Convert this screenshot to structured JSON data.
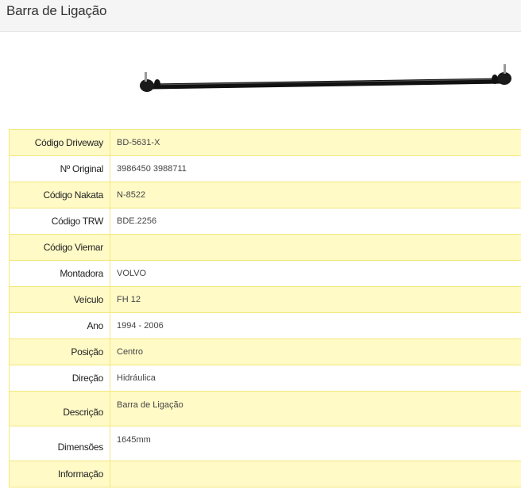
{
  "header": {
    "title": "Barra de Ligação"
  },
  "product_image": {
    "alt_icon": "tie-rod-image"
  },
  "specs": [
    {
      "label": "Código Driveway",
      "value": "BD-5631-X"
    },
    {
      "label": "Nº Original",
      "value": "3986450 3988711"
    },
    {
      "label": "Código Nakata",
      "value": "N-8522"
    },
    {
      "label": "Código TRW",
      "value": "BDE.2256"
    },
    {
      "label": "Código Viemar",
      "value": ""
    },
    {
      "label": "Montadora",
      "value": "VOLVO"
    },
    {
      "label": "Veículo",
      "value": "FH 12"
    },
    {
      "label": "Ano",
      "value": "1994 - 2006"
    },
    {
      "label": "Posição",
      "value": "Centro"
    },
    {
      "label": "Direção",
      "value": "Hidráulica"
    },
    {
      "label": "Descrição",
      "value": "Barra de Ligação"
    },
    {
      "label": "Dimensões",
      "value": "1645mm"
    },
    {
      "label": "Informação",
      "value": ""
    }
  ]
}
